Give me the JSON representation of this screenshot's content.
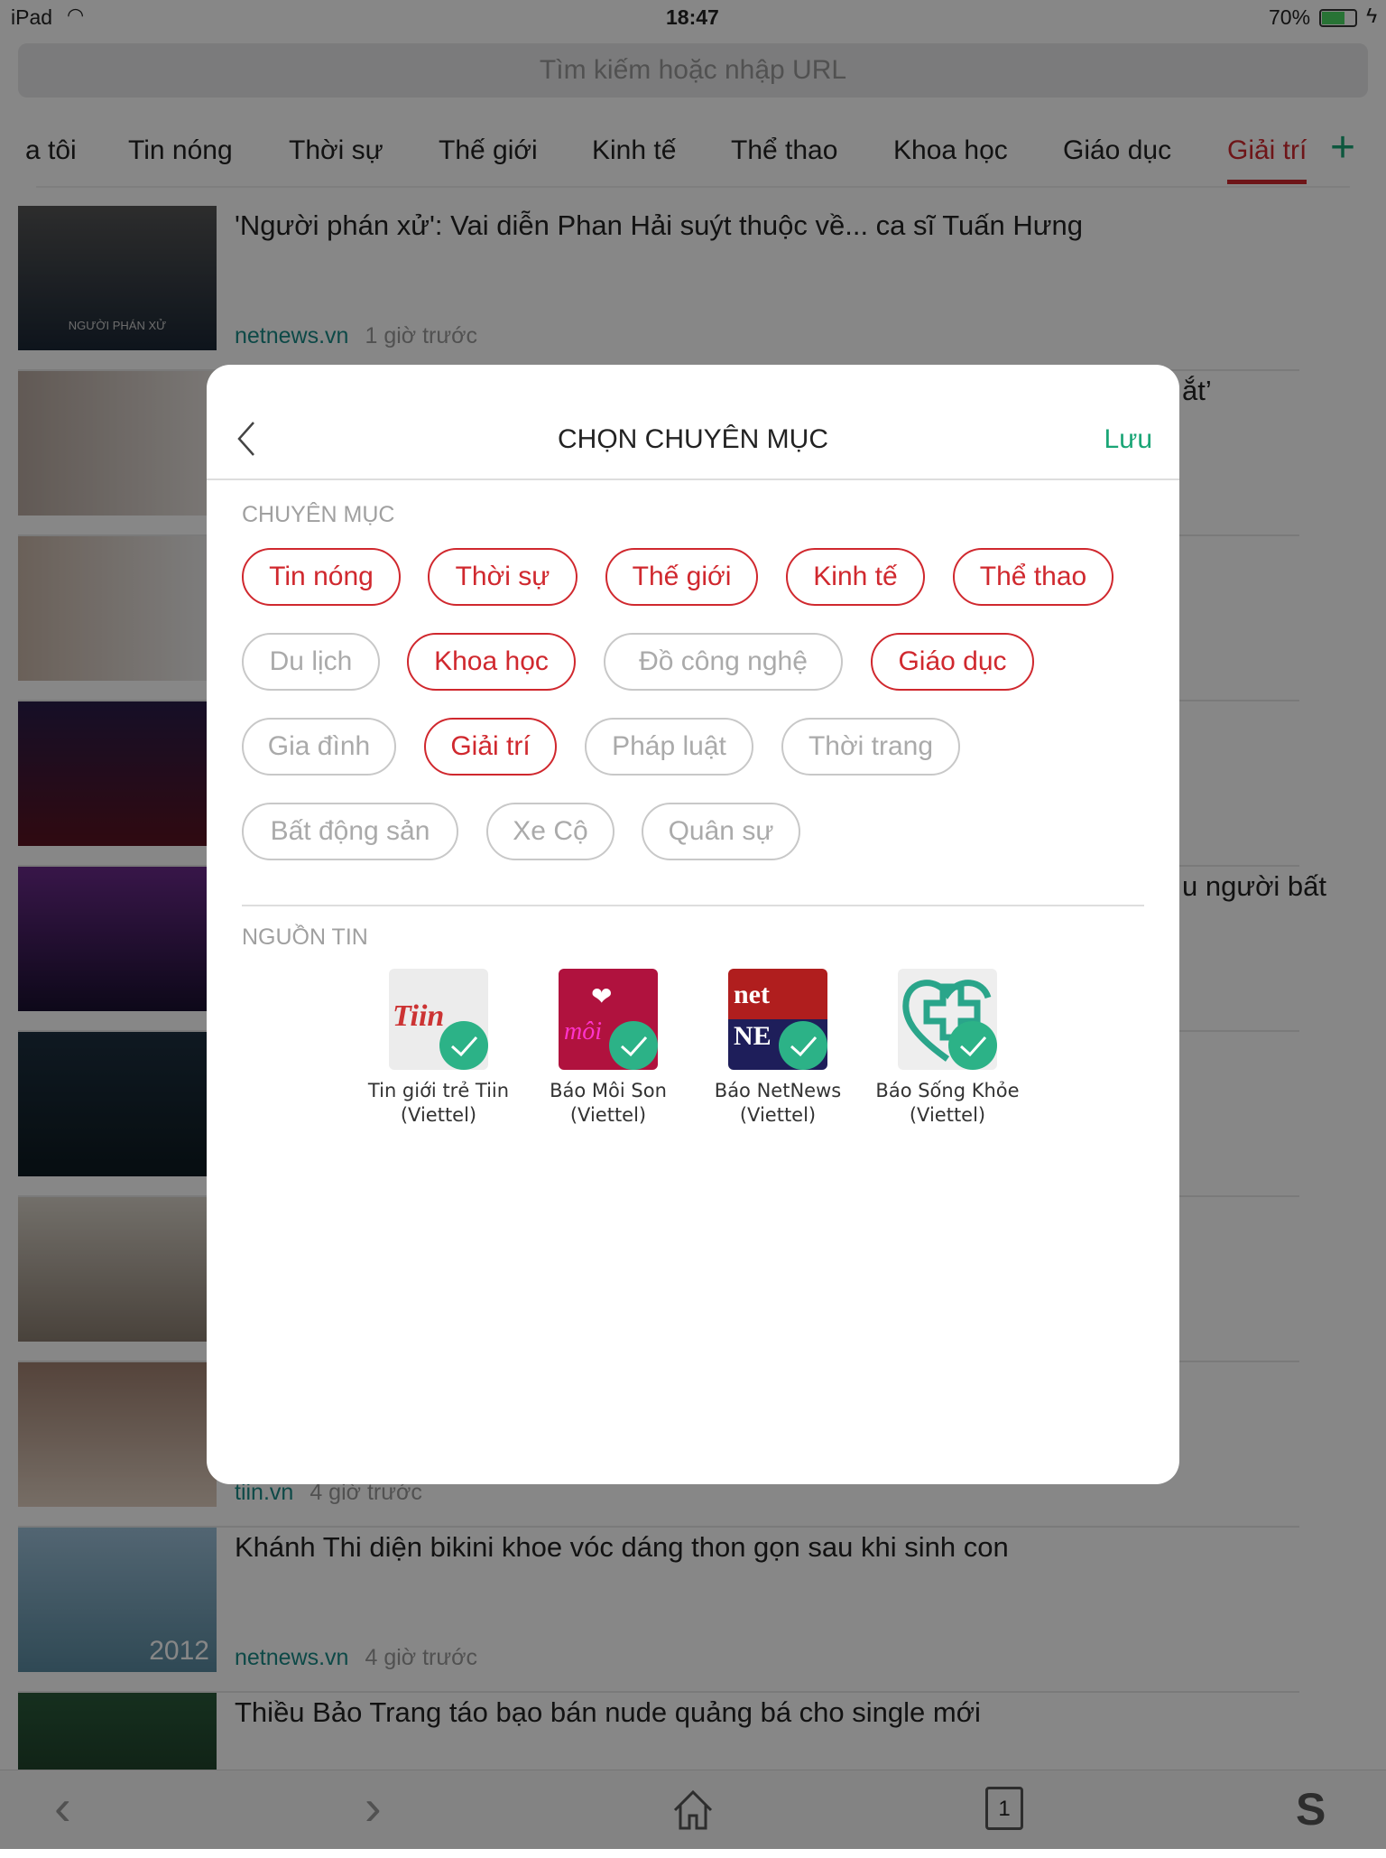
{
  "status": {
    "device": "iPad",
    "time": "18:47",
    "battery": "70%"
  },
  "search": {
    "placeholder": "Tìm kiếm hoặc nhập URL"
  },
  "tabs": [
    {
      "label": "a tôi"
    },
    {
      "label": "Tin nóng"
    },
    {
      "label": "Thời sự"
    },
    {
      "label": "Thế giới"
    },
    {
      "label": "Kinh tế"
    },
    {
      "label": "Thể thao"
    },
    {
      "label": "Khoa học"
    },
    {
      "label": "Giáo dục"
    },
    {
      "label": "Giải trí",
      "active": true
    }
  ],
  "articles": [
    {
      "title": "'Người phán xử': Vai diễn Phan Hải suýt thuộc về... ca sĩ Tuấn Hưng",
      "source": "netnews.vn",
      "time": "1 giờ trước",
      "thumb_caption": "NGƯỜI PHÁN XỬ"
    },
    {
      "title_fragment": "ắt’"
    },
    {
      "title_fragment": "u người bất"
    },
    {
      "source": "tiin.vn",
      "time": "4 giờ trước"
    },
    {
      "title": "Khánh Thi diện bikini khoe vóc dáng thon gọn sau khi sinh con",
      "source": "netnews.vn",
      "time": "4 giờ trước",
      "thumb_caption": "2012"
    },
    {
      "title": "Thiều Bảo Trang táo bạo bán nude quảng bá cho single mới"
    }
  ],
  "toolbar": {
    "tab_count": "1"
  },
  "modal": {
    "title": "CHỌN CHUYÊN MỤC",
    "save_label": "Lưu",
    "categories_label": "CHUYÊN MỤC",
    "categories": [
      {
        "label": "Tin nóng",
        "selected": true
      },
      {
        "label": "Thời sự",
        "selected": true
      },
      {
        "label": "Thế giới",
        "selected": true
      },
      {
        "label": "Kinh tế",
        "selected": true
      },
      {
        "label": "Thể thao",
        "selected": true
      },
      {
        "label": "Du lịch",
        "selected": false
      },
      {
        "label": "Khoa học",
        "selected": true
      },
      {
        "label": "Đồ công nghệ",
        "selected": false
      },
      {
        "label": "Giáo dục",
        "selected": true
      },
      {
        "label": "Gia đình",
        "selected": false
      },
      {
        "label": "Giải trí",
        "selected": true
      },
      {
        "label": "Pháp luật",
        "selected": false
      },
      {
        "label": "Thời trang",
        "selected": false
      },
      {
        "label": "Bất động sản",
        "selected": false
      },
      {
        "label": "Xe Cộ",
        "selected": false
      },
      {
        "label": "Quân sự",
        "selected": false
      }
    ],
    "sources_label": "NGUỒN TIN",
    "sources": [
      {
        "name": "Tin giới trẻ Tiin",
        "sub": "(Viettel)",
        "logo_text": "Tiin.vn",
        "checked": true
      },
      {
        "name": "Báo Môi Son",
        "sub": "(Viettel)",
        "logo_text": "môi",
        "checked": true
      },
      {
        "name": "Báo NetNews",
        "sub": "(Viettel)",
        "logo_text": "net NEWS",
        "checked": true
      },
      {
        "name": "Báo Sống Khỏe",
        "sub": "(Viettel)",
        "checked": true
      }
    ]
  },
  "colors": {
    "accent_red": "#d0282e",
    "accent_green": "#1aa576",
    "check_green": "#2cb287"
  }
}
